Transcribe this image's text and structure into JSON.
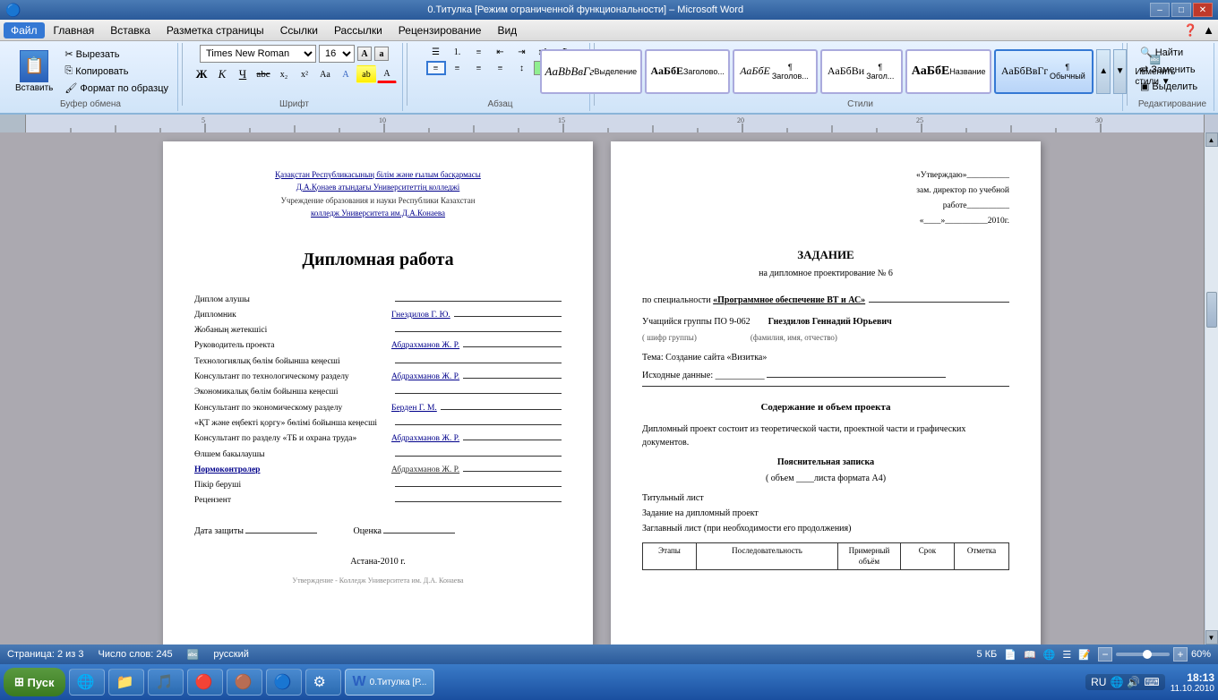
{
  "titlebar": {
    "title": "0.Титулка [Режим ограниченной функциональности] – Microsoft Word",
    "minimize": "–",
    "maximize": "□",
    "close": "✕"
  },
  "menubar": {
    "items": [
      "Файл",
      "Главная",
      "Вставка",
      "Разметка страницы",
      "Ссылки",
      "Рассылки",
      "Рецензирование",
      "Вид"
    ]
  },
  "ribbon": {
    "active_tab": "Главная",
    "clipboard": {
      "paste": "Вставить",
      "cut": "Вырезать",
      "copy": "Копировать",
      "format_painter": "Формат по образцу",
      "group_label": "Буфер обмена"
    },
    "font": {
      "name": "Times New Roman",
      "size": "16",
      "group_label": "Шрифт"
    },
    "paragraph": {
      "group_label": "Абзац"
    },
    "styles": {
      "group_label": "Стили",
      "items": [
        {
          "label": "AaBbВвГг",
          "name": "Выделение",
          "active": false
        },
        {
          "label": "АаБбЕ",
          "name": "Заголово...",
          "active": false
        },
        {
          "label": "АаБбЕ",
          "name": "¶ Заголов...",
          "active": false
        },
        {
          "label": "АаБбВи",
          "name": "¶ Загол...",
          "active": false
        },
        {
          "label": "АаБбЕ",
          "name": "Название",
          "active": false
        },
        {
          "label": "АаБбВвГг",
          "name": "¶ Обычный",
          "active": true
        }
      ]
    },
    "editing": {
      "find": "Найти",
      "replace": "Заменить",
      "select": "Выделить",
      "group_label": "Редактирование"
    }
  },
  "page1": {
    "org_line1": "Қазақстан Республикасының білім және ғылым басқармасы",
    "org_line2": "Д.А.Қонаев атындағы Университеттің колледжі",
    "org_line3": "Учреждение образования и науки Республики Казахстан",
    "org_line4": "колледж Университета им.Д.А.Конаева",
    "title": "Дипломная работа",
    "rows": [
      {
        "label": "Диплом алушы",
        "value": ""
      },
      {
        "label": "Дипломник",
        "value": "Гнездилов Г. Ю."
      },
      {
        "label": "Жобаның жетекшісі",
        "value": ""
      },
      {
        "label": "Руководитель проекта",
        "value": "Абдрахманов Ж. Р."
      },
      {
        "label": "Технологиялық бөлім бойынша кеңесші",
        "value": ""
      },
      {
        "label": "Консультант по технологическому разделу",
        "value": "Абдрахманов Ж. Р."
      },
      {
        "label": "Экономикалық бөлім бойынша кеңесші",
        "value": ""
      },
      {
        "label": "Консультант по экономическому разделу",
        "value": "Берден Г. М."
      },
      {
        "label": "«ҚТ және еңбекті қоргу» бөлімі бойынша кеңесші",
        "value": ""
      },
      {
        "label": "Консультант по разделу «ТБ и охрана труда»",
        "value": "Абдрахманов Ж. Р."
      },
      {
        "label": "Өлшем бакылаушы",
        "value": ""
      },
      {
        "label": "Нормоконтролер",
        "value": "Абдрахманов Ж. Р."
      },
      {
        "label": "Пікір беруші",
        "value": ""
      },
      {
        "label": "Рецензент",
        "value": ""
      }
    ],
    "date_label": "Дата защиты",
    "grade_label": "Оценка",
    "footer": "Астана-2010 г.",
    "footer2": "Утверждение - Колледж Университета им. Д.А. Конаева"
  },
  "page2": {
    "utv_label": "«Утверждаю»__________",
    "utv_role": "зам. директор по учебной",
    "utv_role2": "работе__________",
    "utv_date": "«____»__________2010г.",
    "zadanie_title": "ЗАДАНИЕ",
    "zadanie_sub": "на дипломное проектирование № 6",
    "spec_label": "по специальности",
    "spec_value": "«Программное обеспечение ВТ и АС»",
    "student_label": "Учащийся группы ПО 9-062",
    "student_name": "Гнездилов Геннадий Юрьевич",
    "shifr_label": "( шифр группы)",
    "fio_label": "(фамилия, имя, отчество)",
    "tema_label": "Тема: Создание сайта «Визитка»",
    "data_label": "Исходные данные: ___________",
    "content_title": "Содержание и объем проекта",
    "content_body": "Дипломный проект состоит из теоретической части, проектной части и графических документов.",
    "poyasn_title": "Пояснительная записка",
    "poyasn_sub": "( объем ____листа формата А4)",
    "list_items": [
      "Титульный лист",
      "Задание на дипломный проект",
      "Заглавный лист (при необходимости его продолжения)"
    ],
    "table_headers": [
      "Этапы",
      "Последовательность",
      "Примерный объём",
      "Срок",
      "Отметка"
    ]
  },
  "statusbar": {
    "page_info": "Страница: 2 из 3",
    "word_count": "Число слов: 245",
    "lang": "русский",
    "file_size": "5 КБ",
    "zoom": "60%"
  },
  "taskbar": {
    "start": "Пуск",
    "active_app": "0.Титулка [Р...",
    "time": "18:13",
    "date": "11.10.2010",
    "lang_indicator": "RU"
  }
}
